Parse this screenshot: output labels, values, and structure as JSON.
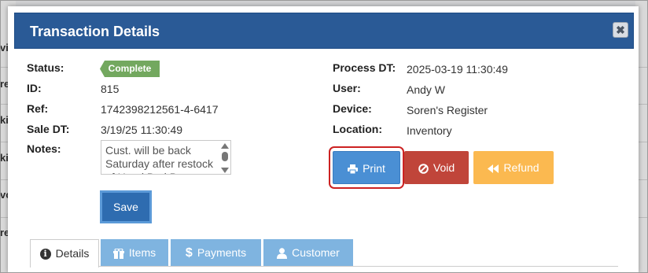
{
  "background": {
    "fragments_left": [
      "vic",
      "re",
      "ki",
      "ki",
      "vo",
      "re"
    ]
  },
  "modal": {
    "title": "Transaction Details",
    "close_label": "✖"
  },
  "left_fields": {
    "status": {
      "label": "Status:",
      "value": "Complete"
    },
    "id": {
      "label": "ID:",
      "value": "815"
    },
    "ref": {
      "label": "Ref:",
      "value": "1742398212561-4-6417"
    },
    "sale_dt": {
      "label": "Sale DT:",
      "value": "3/19/25 11:30:49"
    },
    "notes": {
      "label": "Notes:",
      "value": "Cust. will be back Saturday after restock of Head Bud B"
    }
  },
  "right_fields": {
    "process_dt": {
      "label": "Process DT:",
      "value": "2025-03-19 11:30:49"
    },
    "user": {
      "label": "User:",
      "value": "Andy W"
    },
    "device": {
      "label": "Device:",
      "value": "Soren's Register"
    },
    "location": {
      "label": "Location:",
      "value": "Inventory"
    }
  },
  "buttons": {
    "save": "Save",
    "print": "Print",
    "void": "Void",
    "refund": "Refund"
  },
  "tabs": [
    {
      "label": "Details",
      "icon": "info-icon",
      "active": true
    },
    {
      "label": "Items",
      "icon": "gift-icon",
      "active": false
    },
    {
      "label": "Payments",
      "icon": "dollar-icon",
      "active": false
    },
    {
      "label": "Customer",
      "icon": "user-icon",
      "active": false
    }
  ],
  "colors": {
    "header": "#2a5a96",
    "status_badge": "#73a85f",
    "save": "#2e6cb0",
    "print": "#4a8fd4",
    "void": "#c0453a",
    "refund": "#fbb950",
    "highlight": "#cc2222",
    "tab_inactive": "#7fb4e0"
  }
}
